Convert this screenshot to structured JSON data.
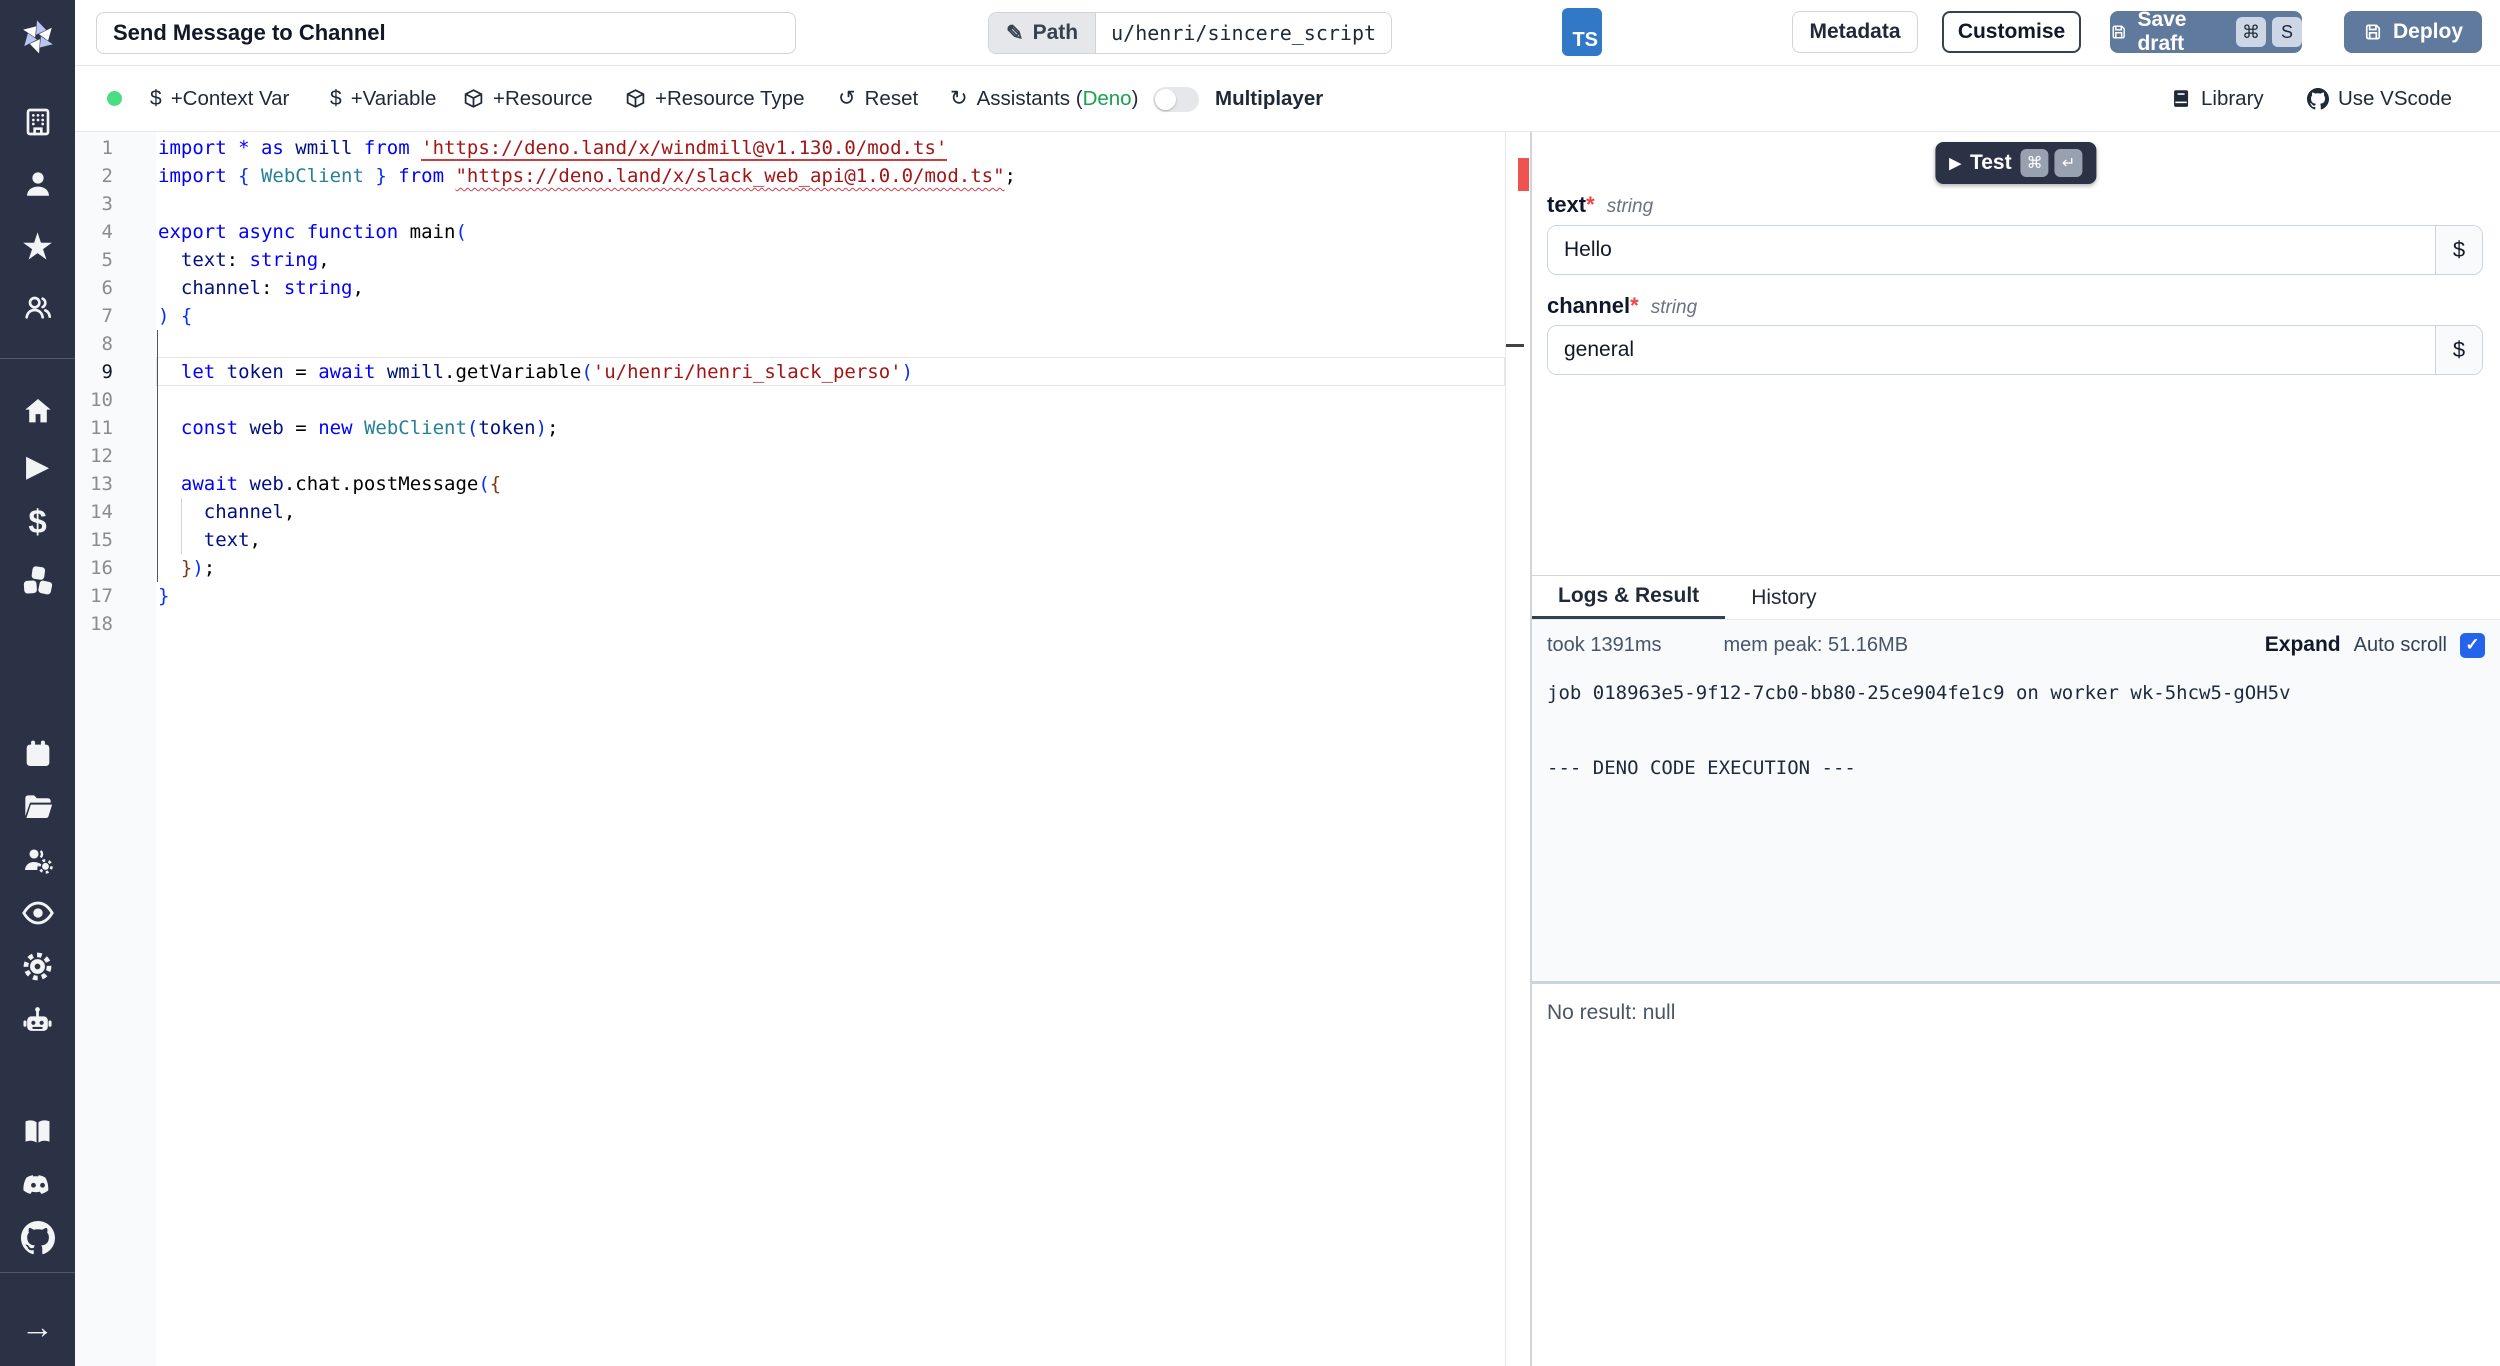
{
  "window": {
    "title_value": "Send Message to Channel"
  },
  "header": {
    "path_label": "Path",
    "path_value": "u/henri/sincere_script",
    "lang_badge": "TS",
    "metadata_label": "Metadata",
    "customise_label": "Customise",
    "save_draft_label": "Save draft",
    "save_kbd": [
      "⌘",
      "S"
    ],
    "deploy_label": "Deploy"
  },
  "toolbar": {
    "dollar": "$",
    "context_var": "+Context Var",
    "variable": "+Variable",
    "resource": "+Resource",
    "resource_type": "+Resource Type",
    "reset": "Reset",
    "assistants_prefix": "Assistants (",
    "assistants_lang": "Deno",
    "assistants_suffix": ")",
    "multiplayer": "Multiplayer",
    "library": "Library",
    "use_vscode": "Use VScode"
  },
  "icons": {
    "pencil": "✎",
    "reset": "↺",
    "assistants": "↻",
    "play": "▶",
    "star": "★",
    "dollar": "$",
    "arrow_right": "→",
    "check": "✓",
    "enter": "↵"
  },
  "editor": {
    "line_count": 18,
    "active_line": 9,
    "lines": [
      [
        [
          "k",
          "import * as "
        ],
        [
          "i",
          "wmill"
        ],
        [
          "k",
          " from "
        ],
        [
          "su",
          "'https://deno.land/x/windmill@v1.130.0/mod.ts'"
        ]
      ],
      [
        [
          "k",
          "import "
        ],
        [
          "b1",
          "{ "
        ],
        [
          "t",
          "WebClient"
        ],
        [
          "b1",
          " }"
        ],
        [
          "k",
          " from "
        ],
        [
          "sw",
          "\"https://deno.land/x/slack_web_api@1.0.0/mod.ts\""
        ],
        [
          "p",
          ";"
        ]
      ],
      [],
      [
        [
          "k",
          "export async function "
        ],
        [
          "p",
          "main"
        ],
        [
          "b1",
          "("
        ]
      ],
      [
        [
          "p",
          "  "
        ],
        [
          "i",
          "text"
        ],
        [
          "p",
          ": "
        ],
        [
          "k",
          "string"
        ],
        [
          "p",
          ","
        ]
      ],
      [
        [
          "p",
          "  "
        ],
        [
          "i",
          "channel"
        ],
        [
          "p",
          ": "
        ],
        [
          "k",
          "string"
        ],
        [
          "p",
          ","
        ]
      ],
      [
        [
          "b1",
          ") {"
        ]
      ],
      [],
      [
        [
          "p",
          "  "
        ],
        [
          "k",
          "let "
        ],
        [
          "i",
          "token"
        ],
        [
          "p",
          " = "
        ],
        [
          "k",
          "await "
        ],
        [
          "i",
          "wmill"
        ],
        [
          "p",
          ".getVariable"
        ],
        [
          "b1",
          "("
        ],
        [
          "s",
          "'u/henri/henri_slack_perso'"
        ],
        [
          "b1",
          ")"
        ]
      ],
      [],
      [
        [
          "p",
          "  "
        ],
        [
          "k",
          "const "
        ],
        [
          "i",
          "web"
        ],
        [
          "p",
          " = "
        ],
        [
          "k",
          "new "
        ],
        [
          "t",
          "WebClient"
        ],
        [
          "b1",
          "("
        ],
        [
          "i",
          "token"
        ],
        [
          "b1",
          ")"
        ],
        [
          "p",
          ";"
        ]
      ],
      [],
      [
        [
          "p",
          "  "
        ],
        [
          "k",
          "await "
        ],
        [
          "i",
          "web"
        ],
        [
          "p",
          ".chat.postMessage"
        ],
        [
          "b1",
          "("
        ],
        [
          "b3",
          "{"
        ]
      ],
      [
        [
          "p",
          "    "
        ],
        [
          "i",
          "channel"
        ],
        [
          "p",
          ","
        ]
      ],
      [
        [
          "p",
          "    "
        ],
        [
          "i",
          "text"
        ],
        [
          "p",
          ","
        ]
      ],
      [
        [
          "p",
          "  "
        ],
        [
          "b3",
          "}"
        ],
        [
          "b1",
          ")"
        ],
        [
          "p",
          ";"
        ]
      ],
      [
        [
          "b1",
          "}"
        ]
      ],
      []
    ]
  },
  "form": {
    "run_label": "Test",
    "run_kbd": [
      "⌘",
      "↵"
    ],
    "required_mark": "*",
    "dollar": "$",
    "fields": [
      {
        "name": "text",
        "type": "string",
        "value": "Hello"
      },
      {
        "name": "channel",
        "type": "string",
        "value": "general"
      }
    ]
  },
  "logs": {
    "tab_logs": "Logs & Result",
    "tab_history": "History",
    "took": "took 1391ms",
    "mem": "mem peak: 51.16MB",
    "expand": "Expand",
    "autoscroll": "Auto scroll",
    "lines": [
      "job 018963e5-9f12-7cb0-bb80-25ce904fe1c9 on worker wk-5hcw5-gOH5v",
      "",
      "",
      "--- DENO CODE EXECUTION ---"
    ],
    "no_result": "No result: null"
  },
  "colors": {
    "sidebar_bg": "#2b3245",
    "primary_button": "#5f7a9c",
    "status_green": "#4ade80",
    "deno_green": "#16a34a",
    "checkbox_blue": "#2563eb",
    "error_marker": "#ef5350",
    "ts_badge": "#3178c6"
  }
}
